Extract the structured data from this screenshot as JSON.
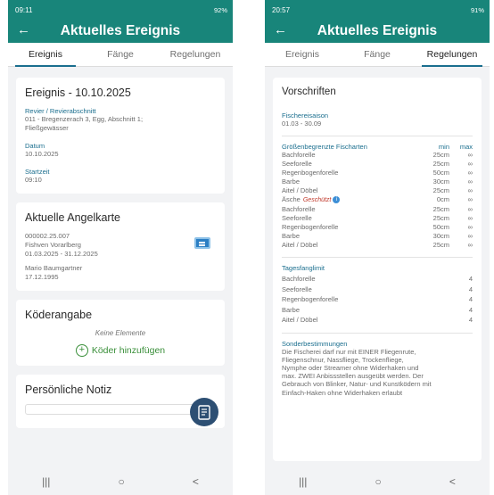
{
  "left": {
    "status": {
      "time": "09:11",
      "right": "92%"
    },
    "appbar": {
      "title": "Aktuelles Ereignis"
    },
    "tabs": [
      "Ereignis",
      "Fänge",
      "Regelungen"
    ],
    "event": {
      "title": "Ereignis - 10.10.2025",
      "revier_label": "Revier / Revierabschnitt",
      "revier_value1": "011 - Bregenzerach 3, Egg, Abschnitt 1;",
      "revier_value2": "Fließgewässer",
      "datum_label": "Datum",
      "datum_value": "10.10.2025",
      "startzeit_label": "Startzeit",
      "startzeit_value": "09:10"
    },
    "license": {
      "title": "Aktuelle Angelkarte",
      "number": "000002.25.007",
      "org": "Fishven Vorarlberg",
      "period": "01.03.2025 - 31.12.2025",
      "holder": "Mario Baumgartner",
      "birth": "17.12.1995"
    },
    "bait": {
      "title": "Köderangabe",
      "empty": "Keine Elemente",
      "add": "Köder hinzufügen"
    },
    "note": {
      "title": "Persönliche Notiz"
    },
    "nav": [
      "|||",
      "○",
      "<"
    ]
  },
  "right": {
    "status": {
      "time": "20:57",
      "right": "91%"
    },
    "appbar": {
      "title": "Aktuelles Ereignis"
    },
    "tabs": [
      "Ereignis",
      "Fänge",
      "Regelungen"
    ],
    "vorschriften": {
      "title": "Vorschriften",
      "saison_label": "Fischereisaison",
      "saison_value": "01.03 - 30.09",
      "groessen_label": "Größenbegrenzte Fischarten",
      "min_label": "min",
      "max_label": "max",
      "protected_label": "Geschützt",
      "fish": [
        {
          "name": "Bachforelle",
          "min": "25cm",
          "max": "∞"
        },
        {
          "name": "Seeforelle",
          "min": "25cm",
          "max": "∞"
        },
        {
          "name": "Regenbogenforelle",
          "min": "50cm",
          "max": "∞"
        },
        {
          "name": "Barbe",
          "min": "30cm",
          "max": "∞"
        },
        {
          "name": "Aitel / Döbel",
          "min": "25cm",
          "max": "∞"
        },
        {
          "name": "Äsche",
          "min": "0cm",
          "max": "∞",
          "protected": true
        },
        {
          "name": "Bachforelle",
          "min": "25cm",
          "max": "∞"
        },
        {
          "name": "Seeforelle",
          "min": "25cm",
          "max": "∞"
        },
        {
          "name": "Regenbogenforelle",
          "min": "50cm",
          "max": "∞"
        },
        {
          "name": "Barbe",
          "min": "30cm",
          "max": "∞"
        },
        {
          "name": "Aitel / Döbel",
          "min": "25cm",
          "max": "∞"
        }
      ],
      "limit_label": "Tagesfanglimit",
      "limits": [
        {
          "name": "Bachforelle",
          "value": "4"
        },
        {
          "name": "Seeforelle",
          "value": "4"
        },
        {
          "name": "Regenbogenforelle",
          "value": "4"
        },
        {
          "name": "Barbe",
          "value": "4"
        },
        {
          "name": "Aitel / Döbel",
          "value": "4"
        }
      ],
      "sonder_label": "Sonderbestimmungen",
      "sonder_lines": [
        "Die Fischerei darf nur mit EINER Fliegenrute,",
        "Fliegenschnur, Nassfliege, Trockenfliege,",
        "Nymphe oder Streamer ohne Widerhaken und",
        "max. ZWEI Anbissstellen ausgeübt werden. Der",
        "Gebrauch von Blinker, Natur- und Kunstködern mit",
        "Einfach-Haken ohne Widerhaken erlaubt"
      ]
    },
    "nav": [
      "|||",
      "○",
      "<"
    ]
  }
}
